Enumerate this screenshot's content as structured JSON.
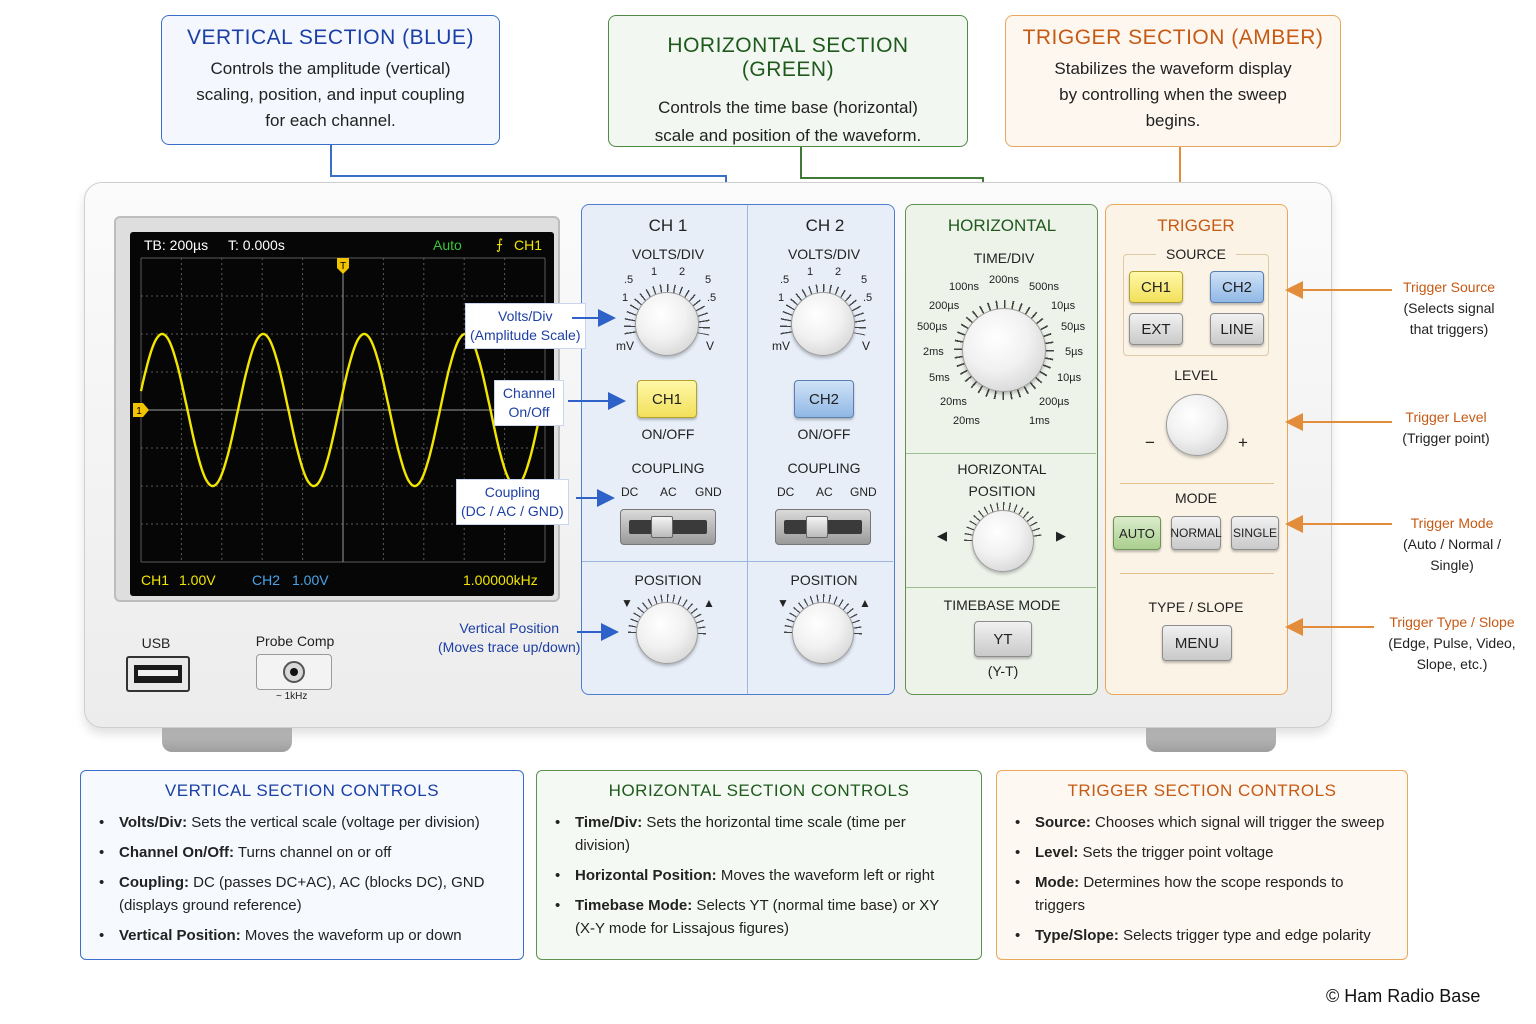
{
  "callouts": {
    "vertical": {
      "title": "VERTICAL SECTION (BLUE)",
      "lines": [
        "Controls the amplitude (vertical)",
        "scaling, position, and input coupling",
        "for each channel."
      ]
    },
    "horizontal": {
      "title": "HORIZONTAL SECTION (GREEN)",
      "lines": [
        "Controls the time base (horizontal)",
        "scale and position of the waveform."
      ]
    },
    "trigger": {
      "title": "TRIGGER SECTION (AMBER)",
      "lines": [
        "Stabilizes the waveform display",
        "by controlling when the sweep",
        "begins."
      ]
    }
  },
  "screen": {
    "timebase": "TB: 200µs",
    "time": "T: 0.000s",
    "mode": "Auto",
    "trig_icon": "⨍",
    "trig_ch": "CH1",
    "trig_marker": "T",
    "ch_marker": "1",
    "ch1_label": "CH1",
    "ch1_val": "1.00V",
    "ch2_label": "CH2",
    "ch2_val": "1.00V",
    "freq": "1.00000kHz"
  },
  "front": {
    "usb": "USB",
    "probe": "Probe Comp",
    "probe_freq": "~ 1kHz"
  },
  "vertical": {
    "ch1": {
      "title": "CH 1",
      "volts_div": "VOLTS/DIV",
      "ticks": [
        ".5",
        "1",
        "2",
        "5",
        "1",
        ".5"
      ],
      "mv": "mV",
      "v": "V",
      "button": "CH1",
      "onoff": "ON/OFF",
      "coupling": "COUPLING",
      "coupling_opts": [
        "DC",
        "AC",
        "GND"
      ],
      "position": "POSITION"
    },
    "ch2": {
      "title": "CH 2",
      "volts_div": "VOLTS/DIV",
      "ticks": [
        ".5",
        "1",
        "2",
        "5",
        "1",
        ".5"
      ],
      "mv": "mV",
      "v": "V",
      "button": "CH2",
      "onoff": "ON/OFF",
      "coupling": "COUPLING",
      "coupling_opts": [
        "DC",
        "AC",
        "GND"
      ],
      "position": "POSITION"
    }
  },
  "horizontal": {
    "title": "HORIZONTAL",
    "time_div": "TIME/DIV",
    "ticks": [
      "100ns",
      "200ns",
      "500ns",
      "200µs",
      "10µs",
      "500µs",
      "50µs",
      "2ms",
      "5µs",
      "5ms",
      "10µs",
      "20ms",
      "200µs",
      "20ms",
      "1ms"
    ],
    "position_l1": "HORIZONTAL",
    "position_l2": "POSITION",
    "timebase_mode": "TIMEBASE MODE",
    "yt_button": "YT",
    "yt_sub": "(Y-T)"
  },
  "trigger": {
    "title": "TRIGGER",
    "source": "SOURCE",
    "buttons": [
      "CH1",
      "CH2",
      "EXT",
      "LINE"
    ],
    "level": "LEVEL",
    "minus": "−",
    "plus": "+",
    "mode": "MODE",
    "mode_buttons": [
      "AUTO",
      "NORMAL",
      "SINGLE"
    ],
    "type_slope": "TYPE / SLOPE",
    "menu": "MENU"
  },
  "annotations_left": {
    "volts_div": [
      "Volts/Div",
      "(Amplitude Scale)"
    ],
    "channel": [
      "Channel",
      "On/Off"
    ],
    "coupling": [
      "Coupling",
      "(DC / AC / GND)"
    ],
    "vpos": [
      "Vertical Position",
      "(Moves trace up/down)"
    ]
  },
  "annotations_right": {
    "source": [
      "Trigger Source",
      "(Selects signal",
      "that triggers)"
    ],
    "level": [
      "Trigger Level",
      "(Trigger point)"
    ],
    "mode": [
      "Trigger Mode",
      "(Auto / Normal /",
      "Single)"
    ],
    "type": [
      "Trigger Type / Slope",
      "(Edge, Pulse, Video,",
      "Slope, etc.)"
    ]
  },
  "bottom": {
    "vertical": {
      "title": "VERTICAL SECTION CONTROLS",
      "items": [
        {
          "k": "Volts/Div:",
          "v": " Sets the vertical scale (voltage per division)"
        },
        {
          "k": "Channel On/Off:",
          "v": " Turns channel on or off"
        },
        {
          "k": "Coupling:",
          "v": " DC (passes DC+AC), AC (blocks DC), GND (displays ground reference)"
        },
        {
          "k": "Vertical Position:",
          "v": " Moves the waveform up or down"
        }
      ]
    },
    "horizontal": {
      "title": "HORIZONTAL SECTION CONTROLS",
      "items": [
        {
          "k": "Time/Div:",
          "v": " Sets the horizontal time scale (time per division)"
        },
        {
          "k": "Horizontal Position:",
          "v": " Moves the waveform left or right"
        },
        {
          "k": "Timebase Mode:",
          "v": " Selects YT (normal time base) or XY (X-Y mode for Lissajous figures)"
        }
      ]
    },
    "trigger": {
      "title": "TRIGGER SECTION CONTROLS",
      "items": [
        {
          "k": "Source:",
          "v": " Chooses which signal will trigger the sweep"
        },
        {
          "k": "Level:",
          "v": " Sets the trigger point voltage"
        },
        {
          "k": "Mode:",
          "v": " Determines how the scope responds to triggers"
        },
        {
          "k": "Type/Slope:",
          "v": " Selects trigger type and edge polarity"
        }
      ]
    }
  },
  "copyright": "© Ham Radio Base",
  "colors": {
    "blue": "#1a3fa6",
    "green": "#1e5a1c",
    "amber": "#c65a15",
    "trace": "#f2e600",
    "ch2": "#4aa3e8"
  },
  "waveform": {
    "cycles": 4,
    "amplitude_div": 2
  }
}
